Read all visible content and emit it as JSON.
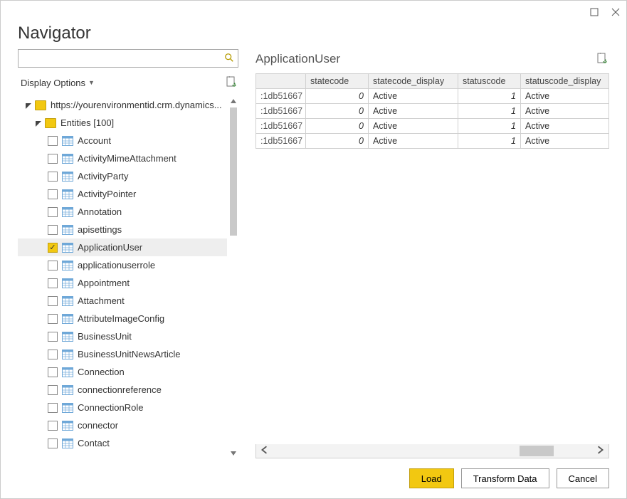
{
  "window": {
    "title": "Navigator"
  },
  "search": {
    "placeholder": ""
  },
  "options": {
    "label": "Display Options"
  },
  "tree": {
    "root_label": "https://yourenvironmentid.crm.dynamics...",
    "entities_label": "Entities [100]",
    "items": [
      {
        "label": "Account",
        "checked": false
      },
      {
        "label": "ActivityMimeAttachment",
        "checked": false
      },
      {
        "label": "ActivityParty",
        "checked": false
      },
      {
        "label": "ActivityPointer",
        "checked": false
      },
      {
        "label": "Annotation",
        "checked": false
      },
      {
        "label": "apisettings",
        "checked": false
      },
      {
        "label": "ApplicationUser",
        "checked": true
      },
      {
        "label": "applicationuserrole",
        "checked": false
      },
      {
        "label": "Appointment",
        "checked": false
      },
      {
        "label": "Attachment",
        "checked": false
      },
      {
        "label": "AttributeImageConfig",
        "checked": false
      },
      {
        "label": "BusinessUnit",
        "checked": false
      },
      {
        "label": "BusinessUnitNewsArticle",
        "checked": false
      },
      {
        "label": "Connection",
        "checked": false
      },
      {
        "label": "connectionreference",
        "checked": false
      },
      {
        "label": "ConnectionRole",
        "checked": false
      },
      {
        "label": "connector",
        "checked": false
      },
      {
        "label": "Contact",
        "checked": false
      }
    ]
  },
  "preview": {
    "title": "ApplicationUser",
    "columns": [
      "",
      "statecode",
      "statecode_display",
      "statuscode",
      "statuscode_display"
    ],
    "rows": [
      {
        "id": ":1db51667",
        "statecode": "0",
        "statecode_display": "Active",
        "statuscode": "1",
        "statuscode_display": "Active"
      },
      {
        "id": ":1db51667",
        "statecode": "0",
        "statecode_display": "Active",
        "statuscode": "1",
        "statuscode_display": "Active"
      },
      {
        "id": ":1db51667",
        "statecode": "0",
        "statecode_display": "Active",
        "statuscode": "1",
        "statuscode_display": "Active"
      },
      {
        "id": ":1db51667",
        "statecode": "0",
        "statecode_display": "Active",
        "statuscode": "1",
        "statuscode_display": "Active"
      }
    ]
  },
  "footer": {
    "load": "Load",
    "transform": "Transform Data",
    "cancel": "Cancel"
  }
}
